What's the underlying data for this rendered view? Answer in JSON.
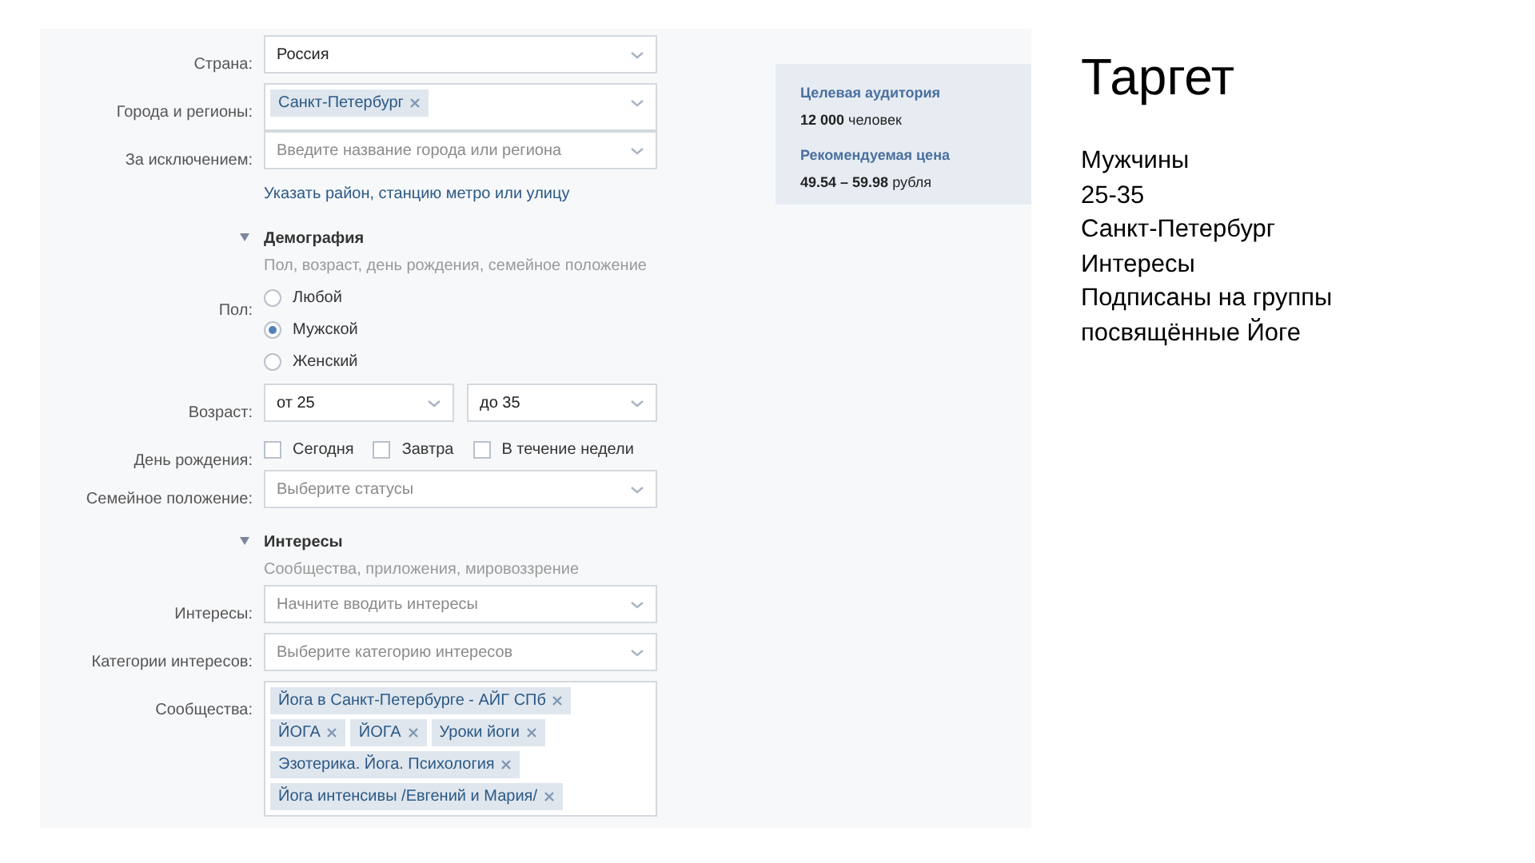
{
  "form": [
    {
      "kind": "select",
      "label": "Страна:",
      "value": "Россия"
    },
    {
      "kind": "tags",
      "label": "Города и регионы:",
      "tags": [
        "Санкт-Петербург"
      ]
    },
    {
      "kind": "select",
      "label": "За исключением:",
      "placeholder": "Введите название города или региона"
    },
    {
      "kind": "link",
      "text": "Указать район, станцию метро или улицу"
    },
    {
      "kind": "section",
      "title": "Демография",
      "subtitle": "Пол, возраст, день рождения, семейное положение",
      "expanded": true
    },
    {
      "kind": "radio",
      "label": "Пол:",
      "options": [
        {
          "label": "Любой",
          "selected": false
        },
        {
          "label": "Мужской",
          "selected": true
        },
        {
          "label": "Женский",
          "selected": false
        }
      ]
    },
    {
      "kind": "range",
      "label": "Возраст:",
      "from": "от 25",
      "to": "до 35"
    },
    {
      "kind": "checks",
      "label": "День рождения:",
      "options": [
        {
          "label": "Сегодня",
          "checked": false
        },
        {
          "label": "Завтра",
          "checked": false
        },
        {
          "label": "В течение недели",
          "checked": false
        }
      ]
    },
    {
      "kind": "select",
      "label": "Семейное положение:",
      "placeholder": "Выберите статусы"
    },
    {
      "kind": "section",
      "title": "Интересы",
      "subtitle": "Сообщества, приложения, мировоззрение",
      "expanded": true
    },
    {
      "kind": "select",
      "label": "Интересы:",
      "placeholder": "Начните вводить интересы"
    },
    {
      "kind": "select",
      "label": "Категории интересов:",
      "placeholder": "Выберите категорию интересов"
    },
    {
      "kind": "tags",
      "label": "Сообщества:",
      "tags": [
        "Йога в Санкт-Петербурге - АЙГ СПб",
        "ЙОГА",
        "ЙОГА",
        "Уроки йоги",
        "Эзотерика. Йога. Психология",
        "Йога интенсивы /Евгений и Мария/"
      ]
    }
  ],
  "summary": [
    {
      "title": "Целевая аудитория",
      "value": "12 000",
      "unit": "человек"
    },
    {
      "title": "Рекомендуемая цена",
      "value": "49.54 – 59.98",
      "unit": "рубля"
    }
  ],
  "slide": {
    "title": "Таргет",
    "lines": [
      "Мужчины",
      "25-35",
      "Санкт-Петербург",
      "Интересы",
      "Подписаны на группы",
      "посвящённые Йоге"
    ]
  }
}
